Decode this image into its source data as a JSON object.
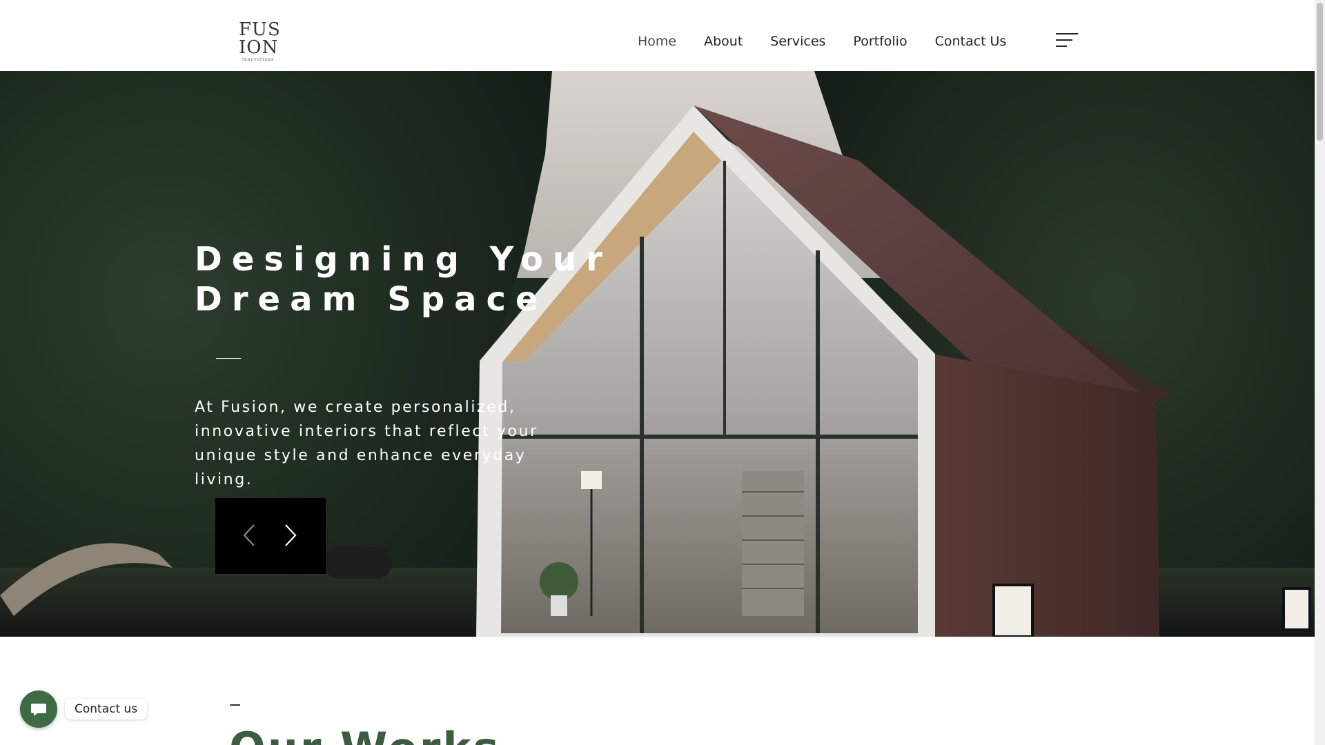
{
  "brand": {
    "logo_line1": "FUS",
    "logo_line2": "ION",
    "logo_tagline": "innovations"
  },
  "nav": {
    "items": [
      {
        "label": "Home",
        "active": true
      },
      {
        "label": "About"
      },
      {
        "label": "Services"
      },
      {
        "label": "Portfolio"
      },
      {
        "label": "Contact Us"
      }
    ],
    "menu_icon": "hamburger-menu-icon"
  },
  "hero": {
    "title_line1": "Designing Your",
    "title_line2": "Dream Space",
    "text": "At Fusion, we create personalized, innovative interiors that reflect your unique style and enhance everyday living.",
    "prev_icon": "chevron-left-icon",
    "next_icon": "chevron-right-icon"
  },
  "works": {
    "title": "Our Works"
  },
  "contact_widget": {
    "label": "Contact us",
    "icon": "chat-icon"
  },
  "colors": {
    "accent_green": "#3e6b45",
    "heading_green": "#3d5b3f",
    "text_dark": "#222222"
  }
}
